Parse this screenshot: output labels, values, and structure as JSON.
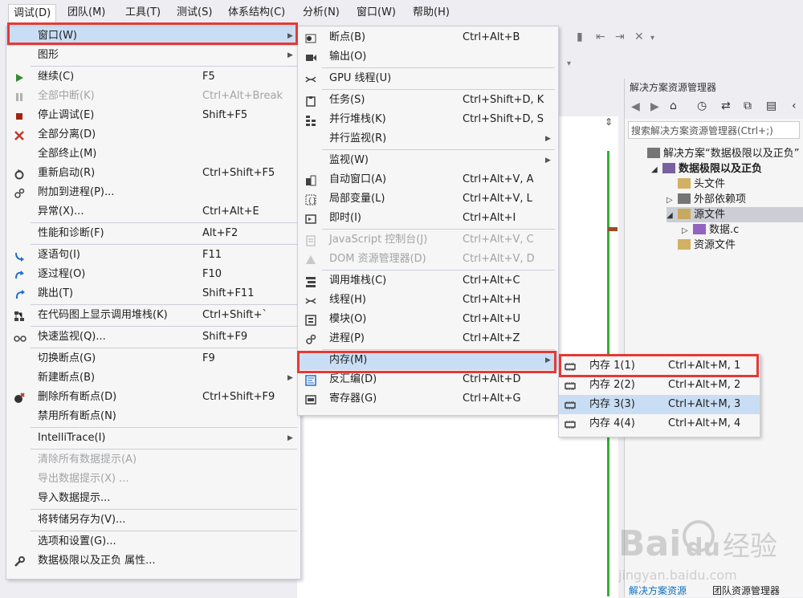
{
  "menubar": [
    "调试(D)",
    "团队(M)",
    "工具(T)",
    "测试(S)",
    "体系结构(C)",
    "分析(N)",
    "窗口(W)",
    "帮助(H)"
  ],
  "debug_menu": [
    {
      "label": "窗口(W)",
      "sub": true,
      "highlight": true,
      "icon": ""
    },
    {
      "label": "图形",
      "sub": true,
      "icon": ""
    },
    {
      "sep": true
    },
    {
      "label": "继续(C)",
      "sc": "F5",
      "icon": "play-icon"
    },
    {
      "label": "全部中断(K)",
      "sc": "Ctrl+Alt+Break",
      "disabled": true,
      "icon": "pause-icon"
    },
    {
      "label": "停止调试(E)",
      "sc": "Shift+F5",
      "icon": "stop-icon"
    },
    {
      "label": "全部分离(D)",
      "icon": "detach-icon"
    },
    {
      "label": "全部终止(M)",
      "icon": ""
    },
    {
      "label": "重新启动(R)",
      "sc": "Ctrl+Shift+F5",
      "icon": "restart-icon"
    },
    {
      "label": "附加到进程(P)...",
      "icon": "attach-icon"
    },
    {
      "label": "异常(X)...",
      "sc": "Ctrl+Alt+E",
      "icon": ""
    },
    {
      "sep": true
    },
    {
      "label": "性能和诊断(F)",
      "sc": "Alt+F2",
      "icon": ""
    },
    {
      "sep": true
    },
    {
      "label": "逐语句(I)",
      "sc": "F11",
      "icon": "step-into-icon"
    },
    {
      "label": "逐过程(O)",
      "sc": "F10",
      "icon": "step-over-icon"
    },
    {
      "label": "跳出(T)",
      "sc": "Shift+F11",
      "icon": "step-out-icon"
    },
    {
      "sep": true
    },
    {
      "label": "在代码图上显示调用堆栈(K)",
      "sc": "Ctrl+Shift+`",
      "icon": "code-map-icon"
    },
    {
      "sep": true
    },
    {
      "label": "快速监视(Q)...",
      "sc": "Shift+F9",
      "icon": "glasses-icon"
    },
    {
      "sep": true
    },
    {
      "label": "切换断点(G)",
      "sc": "F9",
      "icon": ""
    },
    {
      "label": "新建断点(B)",
      "sub": true,
      "icon": ""
    },
    {
      "label": "删除所有断点(D)",
      "sc": "Ctrl+Shift+F9",
      "icon": "delete-breakpoints-icon"
    },
    {
      "label": "禁用所有断点(N)",
      "icon": ""
    },
    {
      "sep": true
    },
    {
      "label": "IntelliTrace(I)",
      "sub": true,
      "icon": ""
    },
    {
      "sep": true
    },
    {
      "label": "清除所有数据提示(A)",
      "disabled": true,
      "icon": ""
    },
    {
      "label": "导出数据提示(X) ...",
      "disabled": true,
      "icon": ""
    },
    {
      "label": "导入数据提示...",
      "icon": ""
    },
    {
      "sep": true
    },
    {
      "label": "将转储另存为(V)...",
      "icon": ""
    },
    {
      "sep": true
    },
    {
      "label": "选项和设置(G)...",
      "icon": ""
    },
    {
      "label": "数据极限以及正负 属性...",
      "icon": "wrench-icon"
    }
  ],
  "window_menu": [
    {
      "label": "断点(B)",
      "sc": "Ctrl+Alt+B",
      "icon": "breakpoints-icon"
    },
    {
      "label": "输出(O)",
      "icon": "output-icon"
    },
    {
      "sep": true
    },
    {
      "label": "GPU 线程(U)",
      "icon": "gpu-threads-icon"
    },
    {
      "sep": true
    },
    {
      "label": "任务(S)",
      "sc": "Ctrl+Shift+D, K",
      "icon": "tasks-icon"
    },
    {
      "label": "并行堆栈(K)",
      "sc": "Ctrl+Shift+D, S",
      "icon": "parallel-stacks-icon"
    },
    {
      "label": "并行监视(R)",
      "sub": true,
      "icon": ""
    },
    {
      "sep": true
    },
    {
      "label": "监视(W)",
      "sub": true,
      "icon": ""
    },
    {
      "label": "自动窗口(A)",
      "sc": "Ctrl+Alt+V, A",
      "icon": "autos-icon"
    },
    {
      "label": "局部变量(L)",
      "sc": "Ctrl+Alt+V, L",
      "icon": "locals-icon"
    },
    {
      "label": "即时(I)",
      "sc": "Ctrl+Alt+I",
      "icon": "immediate-icon"
    },
    {
      "sep": true
    },
    {
      "label": "JavaScript 控制台(J)",
      "sc": "Ctrl+Alt+V, C",
      "disabled": true,
      "icon": "js-console-icon"
    },
    {
      "label": "DOM 资源管理器(D)",
      "sc": "Ctrl+Alt+V, D",
      "disabled": true,
      "icon": "dom-explorer-icon"
    },
    {
      "sep": true
    },
    {
      "label": "调用堆栈(C)",
      "sc": "Ctrl+Alt+C",
      "icon": "call-stack-icon"
    },
    {
      "label": "线程(H)",
      "sc": "Ctrl+Alt+H",
      "icon": "threads-icon"
    },
    {
      "label": "模块(O)",
      "sc": "Ctrl+Alt+U",
      "icon": "modules-icon"
    },
    {
      "label": "进程(P)",
      "sc": "Ctrl+Alt+Z",
      "icon": "processes-icon"
    },
    {
      "sep": true
    },
    {
      "label": "内存(M)",
      "sub": true,
      "highlight": true,
      "icon": ""
    },
    {
      "label": "反汇编(D)",
      "sc": "Ctrl+Alt+D",
      "icon": "disassembly-icon"
    },
    {
      "label": "寄存器(G)",
      "sc": "Ctrl+Alt+G",
      "icon": "registers-icon"
    }
  ],
  "memory_menu": [
    {
      "label": "内存 1(1)",
      "sc": "Ctrl+Alt+M, 1",
      "icon": "memory-icon"
    },
    {
      "label": "内存 2(2)",
      "sc": "Ctrl+Alt+M, 2",
      "icon": "memory-icon"
    },
    {
      "label": "内存 3(3)",
      "sc": "Ctrl+Alt+M, 3",
      "icon": "memory-icon",
      "highlight": true
    },
    {
      "label": "内存 4(4)",
      "sc": "Ctrl+Alt+M, 4",
      "icon": "memory-icon"
    }
  ],
  "solution": {
    "title": "解决方案资源管理器",
    "search_placeholder": "搜索解决方案资源管理器(Ctrl+;)",
    "tree": [
      {
        "label": "解决方案“数据极限以及正负”",
        "indent": 0,
        "arrow": "",
        "bold": false
      },
      {
        "label": "数据极限以及正负",
        "indent": 1,
        "arrow": "◢",
        "bold": true
      },
      {
        "label": "头文件",
        "indent": 2,
        "arrow": "",
        "bold": false
      },
      {
        "label": "外部依赖项",
        "indent": 2,
        "arrow": "▷",
        "bold": false
      },
      {
        "label": "源文件",
        "indent": 2,
        "arrow": "◢",
        "bold": false,
        "selected": true
      },
      {
        "label": "数据.c",
        "indent": 3,
        "arrow": "▷",
        "bold": false
      },
      {
        "label": "资源文件",
        "indent": 2,
        "arrow": "",
        "bold": false
      }
    ]
  },
  "bottom_tabs": [
    "解决方案资源",
    "团队资源管理器"
  ],
  "watermark": {
    "brand": "Bai",
    "brand2": "du",
    "cn": "经验",
    "url": "jingyan.baidu.com"
  },
  "colors": {
    "accent_red": "#e53935",
    "highlight": "#c9def5",
    "green": "#2fb12f"
  }
}
